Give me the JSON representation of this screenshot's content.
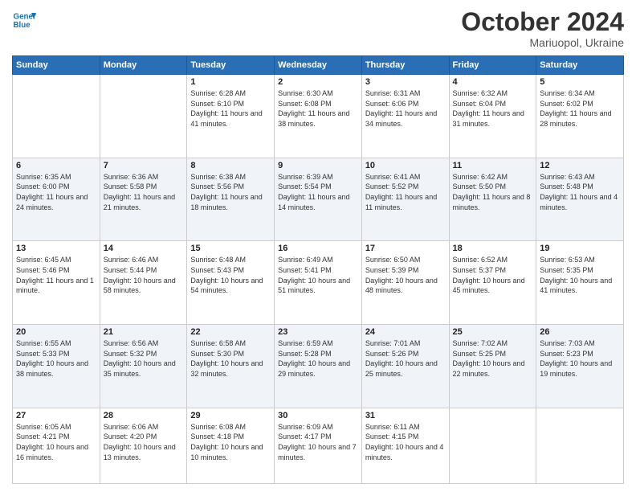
{
  "header": {
    "logo_line1": "General",
    "logo_line2": "Blue",
    "title": "October 2024",
    "location": "Mariuopol, Ukraine"
  },
  "weekdays": [
    "Sunday",
    "Monday",
    "Tuesday",
    "Wednesday",
    "Thursday",
    "Friday",
    "Saturday"
  ],
  "weeks": [
    [
      {
        "day": "",
        "sunrise": "",
        "sunset": "",
        "daylight": ""
      },
      {
        "day": "",
        "sunrise": "",
        "sunset": "",
        "daylight": ""
      },
      {
        "day": "1",
        "sunrise": "Sunrise: 6:28 AM",
        "sunset": "Sunset: 6:10 PM",
        "daylight": "Daylight: 11 hours and 41 minutes."
      },
      {
        "day": "2",
        "sunrise": "Sunrise: 6:30 AM",
        "sunset": "Sunset: 6:08 PM",
        "daylight": "Daylight: 11 hours and 38 minutes."
      },
      {
        "day": "3",
        "sunrise": "Sunrise: 6:31 AM",
        "sunset": "Sunset: 6:06 PM",
        "daylight": "Daylight: 11 hours and 34 minutes."
      },
      {
        "day": "4",
        "sunrise": "Sunrise: 6:32 AM",
        "sunset": "Sunset: 6:04 PM",
        "daylight": "Daylight: 11 hours and 31 minutes."
      },
      {
        "day": "5",
        "sunrise": "Sunrise: 6:34 AM",
        "sunset": "Sunset: 6:02 PM",
        "daylight": "Daylight: 11 hours and 28 minutes."
      }
    ],
    [
      {
        "day": "6",
        "sunrise": "Sunrise: 6:35 AM",
        "sunset": "Sunset: 6:00 PM",
        "daylight": "Daylight: 11 hours and 24 minutes."
      },
      {
        "day": "7",
        "sunrise": "Sunrise: 6:36 AM",
        "sunset": "Sunset: 5:58 PM",
        "daylight": "Daylight: 11 hours and 21 minutes."
      },
      {
        "day": "8",
        "sunrise": "Sunrise: 6:38 AM",
        "sunset": "Sunset: 5:56 PM",
        "daylight": "Daylight: 11 hours and 18 minutes."
      },
      {
        "day": "9",
        "sunrise": "Sunrise: 6:39 AM",
        "sunset": "Sunset: 5:54 PM",
        "daylight": "Daylight: 11 hours and 14 minutes."
      },
      {
        "day": "10",
        "sunrise": "Sunrise: 6:41 AM",
        "sunset": "Sunset: 5:52 PM",
        "daylight": "Daylight: 11 hours and 11 minutes."
      },
      {
        "day": "11",
        "sunrise": "Sunrise: 6:42 AM",
        "sunset": "Sunset: 5:50 PM",
        "daylight": "Daylight: 11 hours and 8 minutes."
      },
      {
        "day": "12",
        "sunrise": "Sunrise: 6:43 AM",
        "sunset": "Sunset: 5:48 PM",
        "daylight": "Daylight: 11 hours and 4 minutes."
      }
    ],
    [
      {
        "day": "13",
        "sunrise": "Sunrise: 6:45 AM",
        "sunset": "Sunset: 5:46 PM",
        "daylight": "Daylight: 11 hours and 1 minute."
      },
      {
        "day": "14",
        "sunrise": "Sunrise: 6:46 AM",
        "sunset": "Sunset: 5:44 PM",
        "daylight": "Daylight: 10 hours and 58 minutes."
      },
      {
        "day": "15",
        "sunrise": "Sunrise: 6:48 AM",
        "sunset": "Sunset: 5:43 PM",
        "daylight": "Daylight: 10 hours and 54 minutes."
      },
      {
        "day": "16",
        "sunrise": "Sunrise: 6:49 AM",
        "sunset": "Sunset: 5:41 PM",
        "daylight": "Daylight: 10 hours and 51 minutes."
      },
      {
        "day": "17",
        "sunrise": "Sunrise: 6:50 AM",
        "sunset": "Sunset: 5:39 PM",
        "daylight": "Daylight: 10 hours and 48 minutes."
      },
      {
        "day": "18",
        "sunrise": "Sunrise: 6:52 AM",
        "sunset": "Sunset: 5:37 PM",
        "daylight": "Daylight: 10 hours and 45 minutes."
      },
      {
        "day": "19",
        "sunrise": "Sunrise: 6:53 AM",
        "sunset": "Sunset: 5:35 PM",
        "daylight": "Daylight: 10 hours and 41 minutes."
      }
    ],
    [
      {
        "day": "20",
        "sunrise": "Sunrise: 6:55 AM",
        "sunset": "Sunset: 5:33 PM",
        "daylight": "Daylight: 10 hours and 38 minutes."
      },
      {
        "day": "21",
        "sunrise": "Sunrise: 6:56 AM",
        "sunset": "Sunset: 5:32 PM",
        "daylight": "Daylight: 10 hours and 35 minutes."
      },
      {
        "day": "22",
        "sunrise": "Sunrise: 6:58 AM",
        "sunset": "Sunset: 5:30 PM",
        "daylight": "Daylight: 10 hours and 32 minutes."
      },
      {
        "day": "23",
        "sunrise": "Sunrise: 6:59 AM",
        "sunset": "Sunset: 5:28 PM",
        "daylight": "Daylight: 10 hours and 29 minutes."
      },
      {
        "day": "24",
        "sunrise": "Sunrise: 7:01 AM",
        "sunset": "Sunset: 5:26 PM",
        "daylight": "Daylight: 10 hours and 25 minutes."
      },
      {
        "day": "25",
        "sunrise": "Sunrise: 7:02 AM",
        "sunset": "Sunset: 5:25 PM",
        "daylight": "Daylight: 10 hours and 22 minutes."
      },
      {
        "day": "26",
        "sunrise": "Sunrise: 7:03 AM",
        "sunset": "Sunset: 5:23 PM",
        "daylight": "Daylight: 10 hours and 19 minutes."
      }
    ],
    [
      {
        "day": "27",
        "sunrise": "Sunrise: 6:05 AM",
        "sunset": "Sunset: 4:21 PM",
        "daylight": "Daylight: 10 hours and 16 minutes."
      },
      {
        "day": "28",
        "sunrise": "Sunrise: 6:06 AM",
        "sunset": "Sunset: 4:20 PM",
        "daylight": "Daylight: 10 hours and 13 minutes."
      },
      {
        "day": "29",
        "sunrise": "Sunrise: 6:08 AM",
        "sunset": "Sunset: 4:18 PM",
        "daylight": "Daylight: 10 hours and 10 minutes."
      },
      {
        "day": "30",
        "sunrise": "Sunrise: 6:09 AM",
        "sunset": "Sunset: 4:17 PM",
        "daylight": "Daylight: 10 hours and 7 minutes."
      },
      {
        "day": "31",
        "sunrise": "Sunrise: 6:11 AM",
        "sunset": "Sunset: 4:15 PM",
        "daylight": "Daylight: 10 hours and 4 minutes."
      },
      {
        "day": "",
        "sunrise": "",
        "sunset": "",
        "daylight": ""
      },
      {
        "day": "",
        "sunrise": "",
        "sunset": "",
        "daylight": ""
      }
    ]
  ]
}
